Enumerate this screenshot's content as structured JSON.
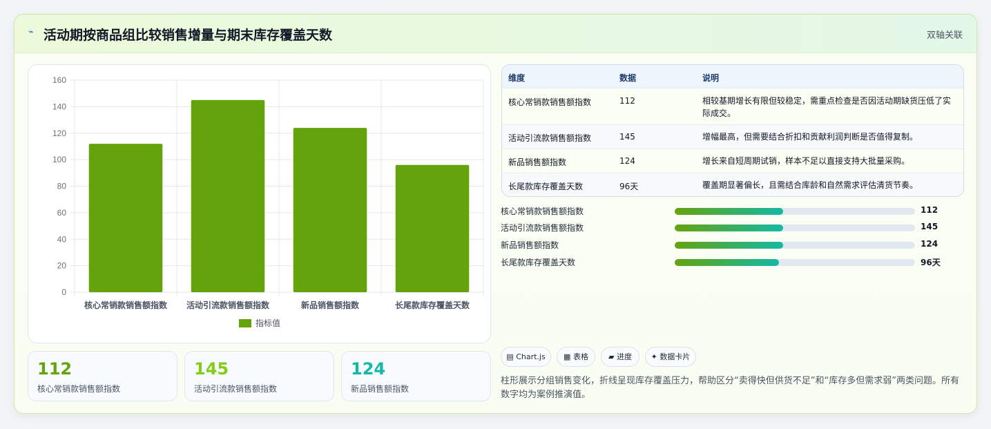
{
  "header": {
    "icon": "lightning-icon",
    "title": "活动期按商品组比较销售增量与期末库存覆盖天数",
    "right_label": "双轴关联"
  },
  "chart_data": {
    "type": "bar",
    "categories": [
      "核心常销款销售额指数",
      "活动引流款销售额指数",
      "新品销售额指数",
      "长尾款库存覆盖天数"
    ],
    "series": [
      {
        "name": "指标值",
        "values": [
          112,
          145,
          124,
          96
        ],
        "color": "#65a30d"
      }
    ],
    "ylim": [
      0,
      160
    ],
    "yticks": [
      0,
      20,
      40,
      60,
      80,
      100,
      120,
      140,
      160
    ],
    "grid": true,
    "legend": "bottom"
  },
  "stats": [
    {
      "value": "112",
      "label": "核心常销款销售额指数",
      "color": "#65a30d"
    },
    {
      "value": "145",
      "label": "活动引流款销售额指数",
      "color": "#84cc16"
    },
    {
      "value": "124",
      "label": "新品销售额指数",
      "color": "#14b8a6"
    }
  ],
  "table": {
    "headers": [
      "维度",
      "数据",
      "说明"
    ],
    "rows": [
      {
        "dim": "核心常销款销售额指数",
        "val": "112",
        "desc": "相较基期增长有限但较稳定，需重点检查是否因活动期缺货压低了实际成交。"
      },
      {
        "dim": "活动引流款销售额指数",
        "val": "145",
        "desc": "增幅最高，但需要结合折扣和贡献利润判断是否值得复制。"
      },
      {
        "dim": "新品销售额指数",
        "val": "124",
        "desc": "增长来自短周期试销，样本不足以直接支持大批量采购。"
      },
      {
        "dim": "长尾款库存覆盖天数",
        "val": "96天",
        "desc": "覆盖期显著偏长，且需结合库龄和自然需求评估清货节奏。"
      }
    ]
  },
  "progress": [
    {
      "label": "核心常销款销售额指数",
      "value": "112",
      "fraction": 0.45
    },
    {
      "label": "活动引流款销售额指数",
      "value": "145",
      "fraction": 0.45
    },
    {
      "label": "新品销售额指数",
      "value": "124",
      "fraction": 0.45
    },
    {
      "label": "长尾款库存覆盖天数",
      "value": "96天",
      "fraction": 0.435
    }
  ],
  "pills": [
    {
      "icon": "chart-icon",
      "label": "Chart.js"
    },
    {
      "icon": "table-icon",
      "label": "表格"
    },
    {
      "icon": "progress-icon",
      "label": "进度"
    },
    {
      "icon": "card-icon",
      "label": "数据卡片"
    }
  ],
  "note": "柱形展示分组销售变化，折线呈现库存覆盖压力，帮助区分“卖得快但供货不足”和“库存多但需求弱”两类问题。所有数字均为案例推演值。"
}
